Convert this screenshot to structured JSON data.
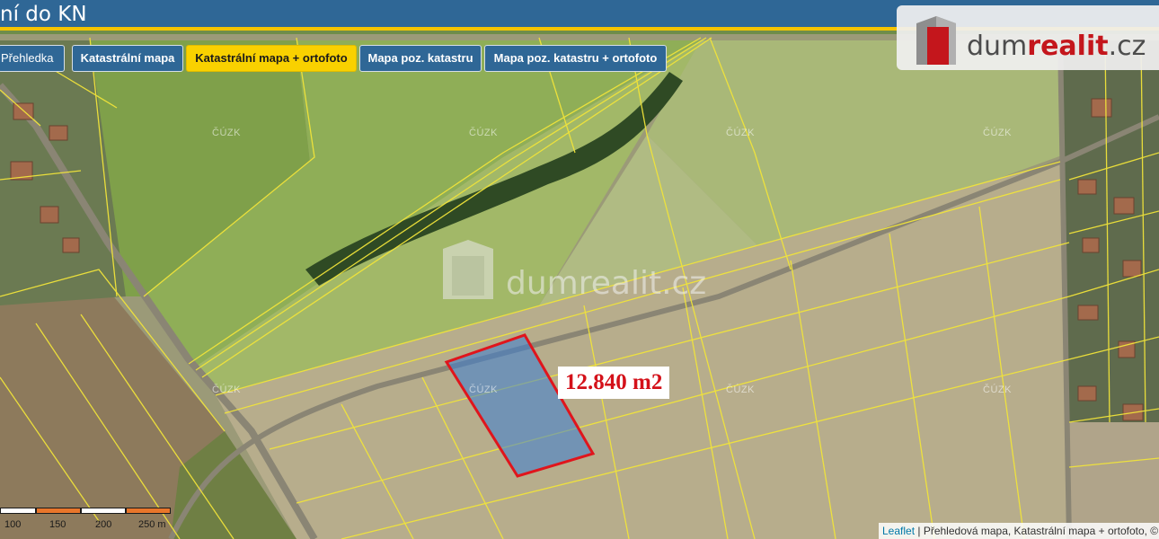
{
  "header": {
    "title": "ní do KN"
  },
  "layer_tabs": [
    {
      "label": "Přehledka",
      "active": false
    },
    {
      "label": "Katastrální mapa",
      "active": false
    },
    {
      "label": "Katastrální mapa + ortofoto",
      "active": true
    },
    {
      "label": "Mapa poz. katastru",
      "active": false
    },
    {
      "label": "Mapa poz. katastru + ortofoto",
      "active": false
    }
  ],
  "brand": {
    "name_prefix": "dum",
    "name_accent": "realit",
    "name_suffix": ".cz",
    "accent_color": "#c4161c"
  },
  "watermark": {
    "text": "dumrealit.cz"
  },
  "map_labels": {
    "cuzk": "ČÚZK"
  },
  "parcel": {
    "area_label": "12.840 m2",
    "outline_color": "#e0151c",
    "fill_color": "#3b7ed6"
  },
  "scale": {
    "labels": [
      "100",
      "150",
      "200",
      "250 m"
    ]
  },
  "attribution": {
    "link": "Leaflet",
    "separator": " | ",
    "text": "Přehledová mapa, Katastrální mapa + ortofoto, ©"
  },
  "colors": {
    "header_bg": "#2f6796",
    "header_underline": "#f5c400",
    "active_tab": "#f9d100",
    "parcel_lines": "#f1e43a"
  }
}
